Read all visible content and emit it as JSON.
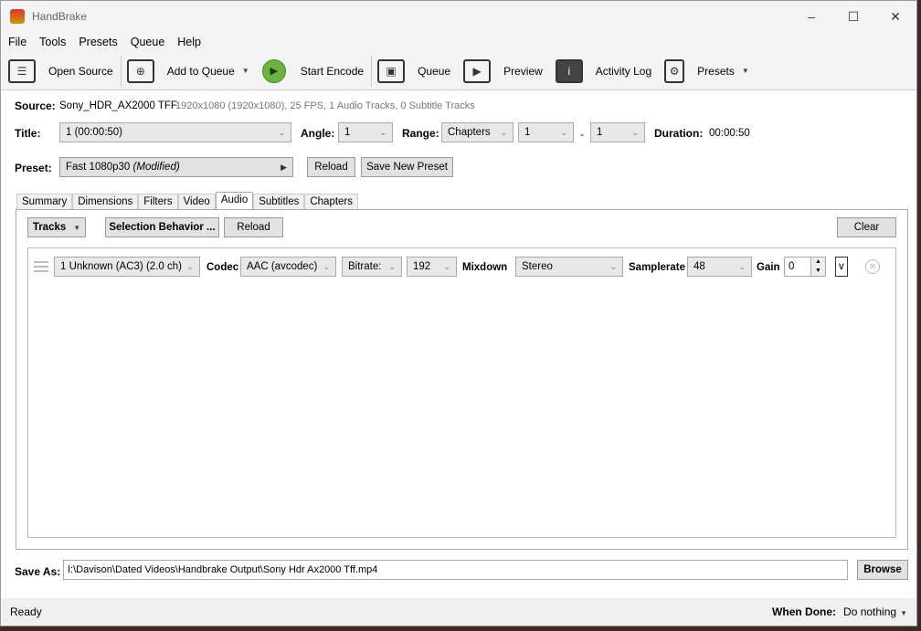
{
  "app": {
    "title": "HandBrake"
  },
  "menu": [
    "File",
    "Tools",
    "Presets",
    "Queue",
    "Help"
  ],
  "toolbar": {
    "open_source": "Open Source",
    "add_to_queue": "Add to Queue",
    "start_encode": "Start Encode",
    "queue": "Queue",
    "preview": "Preview",
    "activity_log": "Activity Log",
    "presets": "Presets"
  },
  "source": {
    "label": "Source:",
    "name": "Sony_HDR_AX2000 TFF",
    "info": "1920x1080 (1920x1080), 25 FPS, 1 Audio Tracks, 0 Subtitle Tracks"
  },
  "title_row": {
    "title_label": "Title:",
    "title_value": "1  (00:00:50)",
    "angle_label": "Angle:",
    "angle_value": "1",
    "range_label": "Range:",
    "range_type": "Chapters",
    "range_start": "1",
    "range_sep": "-",
    "range_end": "1",
    "duration_label": "Duration:",
    "duration_value": "00:00:50"
  },
  "preset_row": {
    "label": "Preset:",
    "value": "Fast 1080p30",
    "modified": "(Modified)",
    "reload": "Reload",
    "save_new": "Save New Preset"
  },
  "tabs": [
    "Summary",
    "Dimensions",
    "Filters",
    "Video",
    "Audio",
    "Subtitles",
    "Chapters"
  ],
  "audio": {
    "tracks": "Tracks",
    "selection_behavior": "Selection Behavior ...",
    "reload": "Reload",
    "clear": "Clear",
    "track": {
      "source": "1 Unknown (AC3) (2.0 ch)",
      "codec_label": "Codec",
      "codec": "AAC (avcodec)",
      "bitrate_mode": "Bitrate:",
      "bitrate": "192",
      "mixdown_label": "Mixdown",
      "mixdown": "Stereo",
      "samplerate_label": "Samplerate",
      "samplerate": "48",
      "gain_label": "Gain",
      "gain": "0",
      "drc": "v"
    }
  },
  "save_as": {
    "label": "Save As:",
    "path": "I:\\Davison\\Dated Videos\\Handbrake Output\\Sony Hdr Ax2000 Tff.mp4",
    "browse": "Browse"
  },
  "status": {
    "text": "Ready",
    "when_done_label": "When Done:",
    "when_done_value": "Do nothing"
  }
}
